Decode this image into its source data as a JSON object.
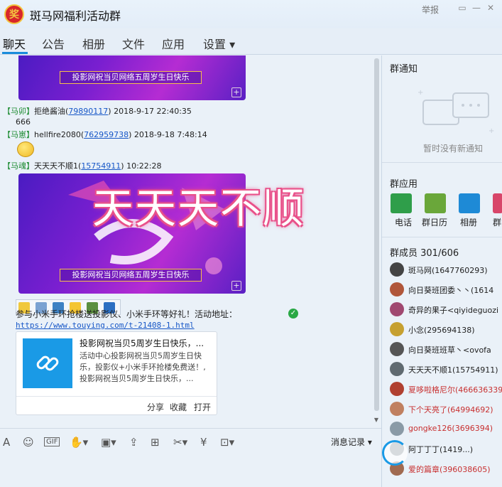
{
  "window": {
    "title": "斑马网福利活动群",
    "logo_char": "奖",
    "report": "举报"
  },
  "tabs": [
    {
      "label": "聊天"
    },
    {
      "label": "公告"
    },
    {
      "label": "相册"
    },
    {
      "label": "文件"
    },
    {
      "label": "应用"
    },
    {
      "label": "设置 ▾"
    }
  ],
  "chat": {
    "banner_caption": "投影网祝当贝网络五周岁生日快乐",
    "messages": [
      {
        "role": "【马卯】",
        "name": "拒绝酱油",
        "qq": "79890117",
        "time": "2018-9-17 22:40:35",
        "text": "666"
      },
      {
        "role": "【马崽】",
        "name": "hellfire2080",
        "qq": "762959738",
        "time": "2018-9-18 7:48:14"
      },
      {
        "role": "【马魂】",
        "name": "天天天不顺1",
        "qq": "15754911",
        "time": "10:22:28"
      }
    ],
    "overlay_text": "天天天不顺",
    "link_text": "参与小米手环抢楼送投影仪、小米手环等好礼！活动地址：",
    "link_url": "https://www.touying.com/t-21408-1.html",
    "card": {
      "title": "投影网祝当贝5周岁生日快乐，...",
      "desc": "活动中心投影网祝当贝5周岁生日快乐，投影仪+小米手环抢楼免费送！,投影网祝当贝5周岁生日快乐，...",
      "share": "分享",
      "fav": "收藏",
      "open": "打开"
    }
  },
  "toolbar": {
    "msg_record": "消息记录 ▾"
  },
  "notice": {
    "header": "群通知",
    "empty": "暂时没有新通知"
  },
  "apps": {
    "header": "群应用",
    "items": [
      {
        "label": "电话",
        "color": "#2f9e4a"
      },
      {
        "label": "群日历",
        "color": "#6aa73a"
      },
      {
        "label": "相册",
        "color": "#1e8ad6"
      },
      {
        "label": "群",
        "color": "#d8466a"
      }
    ]
  },
  "members": {
    "header": "群成员 301/606",
    "list": [
      {
        "name": "斑马网",
        "id": "(1647760293)",
        "red": false,
        "color": "#444"
      },
      {
        "name": "向日葵班团委丶丶",
        "id": "(1614",
        "red": false,
        "color": "#b0563a"
      },
      {
        "name": "奇异的果子",
        "id": "<qiyideguozi",
        "red": false,
        "color": "#a04870"
      },
      {
        "name": "小念",
        "id": "(295694138)",
        "red": false,
        "color": "#c6a030"
      },
      {
        "name": "向日葵班班草丶",
        "id": "<ovofa",
        "red": false,
        "color": "#555"
      },
      {
        "name": "天天天不顺1",
        "id": "(15754911)",
        "red": false,
        "color": "#606a70"
      },
      {
        "name": "夏哆啦格尼尔",
        "id": "(466636339)",
        "red": true,
        "color": "#b04030"
      },
      {
        "name": "下个天亮了",
        "id": "(64994692)",
        "red": true,
        "color": "#c08060"
      },
      {
        "name": "gongke126",
        "id": "(3696394)",
        "red": true,
        "color": "#8a9aa6"
      },
      {
        "name": "阿丁丁丁",
        "id": "(1419...)",
        "red": false,
        "color": "#7a8890"
      },
      {
        "name": "爱的篇章",
        "id": "(396038605)",
        "red": true,
        "color": "#a06a50"
      }
    ]
  }
}
